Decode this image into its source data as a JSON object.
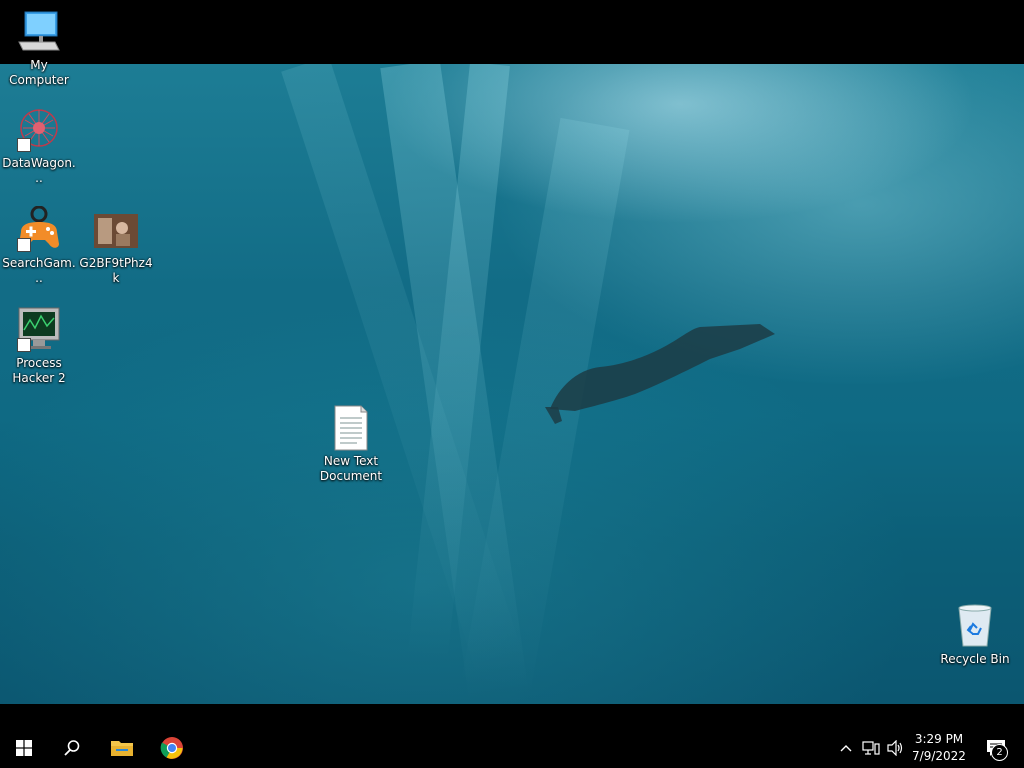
{
  "desktop": {
    "icons": [
      {
        "label": "My Computer",
        "icon": "computer-icon"
      },
      {
        "label": "DataWagon...",
        "icon": "network-graph-icon"
      },
      {
        "label": "SearchGam...",
        "icon": "gamepad-icon"
      },
      {
        "label": "G2BF9tPhz4k",
        "icon": "image-thumbnail-icon"
      },
      {
        "label": "Process Hacker 2",
        "icon": "monitor-chart-icon"
      },
      {
        "label": "New Text Document",
        "icon": "text-file-icon"
      },
      {
        "label": "Recycle Bin",
        "icon": "recycle-bin-icon"
      }
    ]
  },
  "taskbar": {
    "start": "windows-logo-icon",
    "search": "search-icon",
    "pinned": [
      "folder-icon",
      "chrome-icon"
    ],
    "tray": {
      "time": "3:29 PM",
      "date": "7/9/2022",
      "notification_count": "2"
    }
  },
  "colors": {
    "taskbar": "#000000",
    "water_deep": "#0b5670",
    "water_light": "#1d7d95"
  }
}
